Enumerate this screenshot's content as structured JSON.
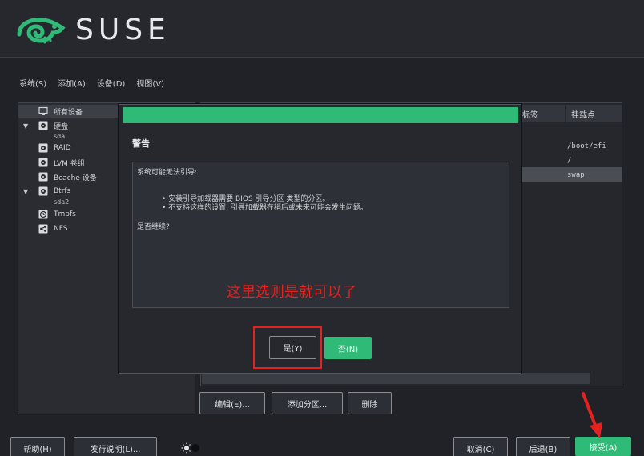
{
  "brand": {
    "name": "SUSE",
    "green": "#30ba78",
    "logo_icon": "chameleon-icon"
  },
  "menu": [
    "系统(S)",
    "添加(A)",
    "设备(D)",
    "视图(V)"
  ],
  "tree": {
    "items": [
      {
        "label": "所有设备",
        "icon": "monitor-icon",
        "selected": true
      },
      {
        "label": "硬盘",
        "icon": "disk-icon",
        "expanded": true,
        "sub": "sda"
      },
      {
        "label": "RAID",
        "icon": "disk-icon"
      },
      {
        "label": "LVM 卷组",
        "icon": "disk-icon"
      },
      {
        "label": "Bcache 设备",
        "icon": "disk-icon"
      },
      {
        "label": "Btrfs",
        "icon": "disk-icon",
        "expanded": true,
        "sub": "sda2"
      },
      {
        "label": "Tmpfs",
        "icon": "clock-icon"
      },
      {
        "label": "NFS",
        "icon": "share-icon"
      }
    ]
  },
  "table": {
    "columns": [
      "标签",
      "挂载点"
    ],
    "mount_points": [
      "/boot/efi",
      "/",
      "swap"
    ]
  },
  "partition_buttons": {
    "edit": "编辑(E)...",
    "add_partition": "添加分区...",
    "delete": "删除"
  },
  "dialog": {
    "title": "警告",
    "intro": "系统可能无法引导:",
    "bullets": [
      "• 安装引导加载器需要 BIOS 引导分区 类型的分区。",
      "• 不支持这样的设置, 引导加载器在稍后或未来可能会发生问题。"
    ],
    "question": "是否继续?",
    "yes": "是(Y)",
    "no": "否(N)"
  },
  "annotation": "这里选则是就可以了",
  "footer": {
    "help": "帮助(H)",
    "release_notes": "发行说明(L)...",
    "cancel": "取消(C)",
    "back": "后退(B)",
    "accept": "接受(A)"
  }
}
